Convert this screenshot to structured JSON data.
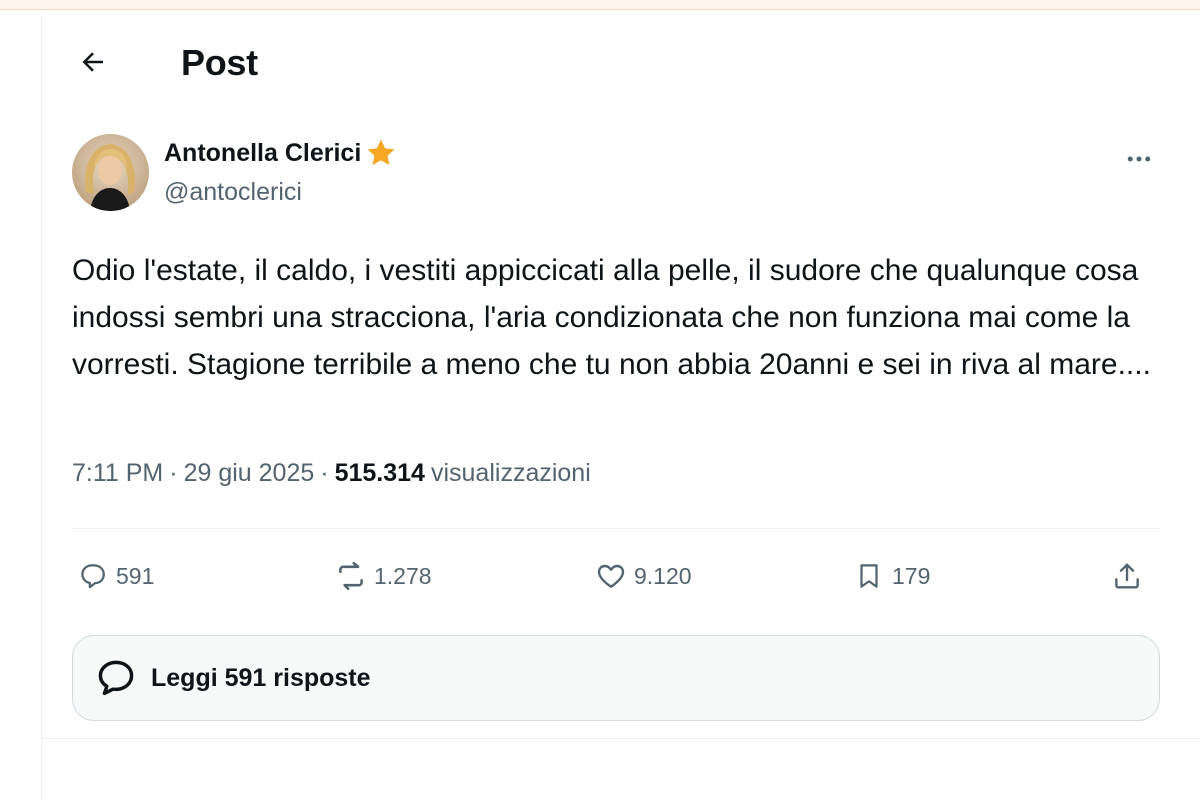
{
  "header": {
    "title": "Post",
    "back_icon": "arrow-left-icon"
  },
  "author": {
    "name": "Antonella Clerici",
    "handle": "@antoclerici",
    "badge_icon": "star-icon",
    "badge_color": "#f5a623"
  },
  "tweet": {
    "text": "Odio l'estate, il caldo, i vestiti appiccicati alla pelle, il sudore che qualunque cosa indossi sembri una stracciona, l'aria condizionata che non funziona mai come la vorresti. Stagione terribile a meno che tu non abbia 20anni e sei in riva al mare....",
    "time": "7:11 PM",
    "separator": "·",
    "date": "29 giu 2025",
    "views_count": "515.314",
    "views_label": "visualizzazioni"
  },
  "actions": {
    "replies": "591",
    "reposts": "1.278",
    "likes": "9.120",
    "bookmarks": "179"
  },
  "read_replies": {
    "label": "Leggi 591 risposte"
  },
  "colors": {
    "text_primary": "#0f1419",
    "text_secondary": "#536471",
    "divider": "#eff3f4",
    "accent_star": "#f5a623"
  }
}
